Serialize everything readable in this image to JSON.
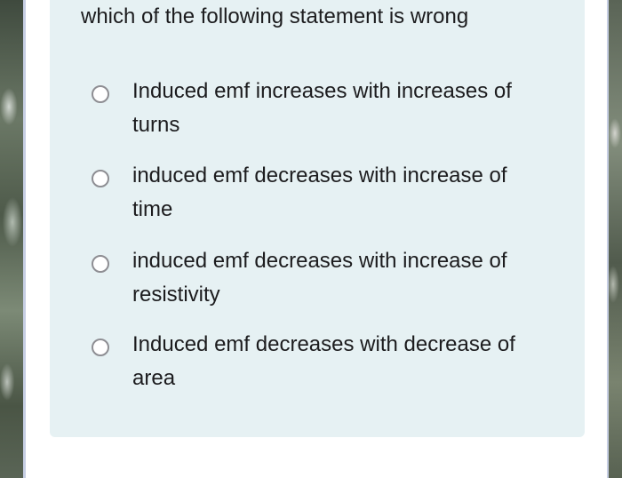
{
  "question": {
    "text": "which of the following statement is wrong"
  },
  "options": [
    {
      "label": "Induced emf increases with increases of turns"
    },
    {
      "label": "induced emf decreases with increase of time"
    },
    {
      "label": "induced emf decreases with increase of resistivity"
    },
    {
      "label": "Induced emf decreases with decrease of area"
    }
  ],
  "colors": {
    "card_background": "#e6f1f3",
    "text": "#1c1c1e",
    "radio_border": "#8e8e93"
  }
}
